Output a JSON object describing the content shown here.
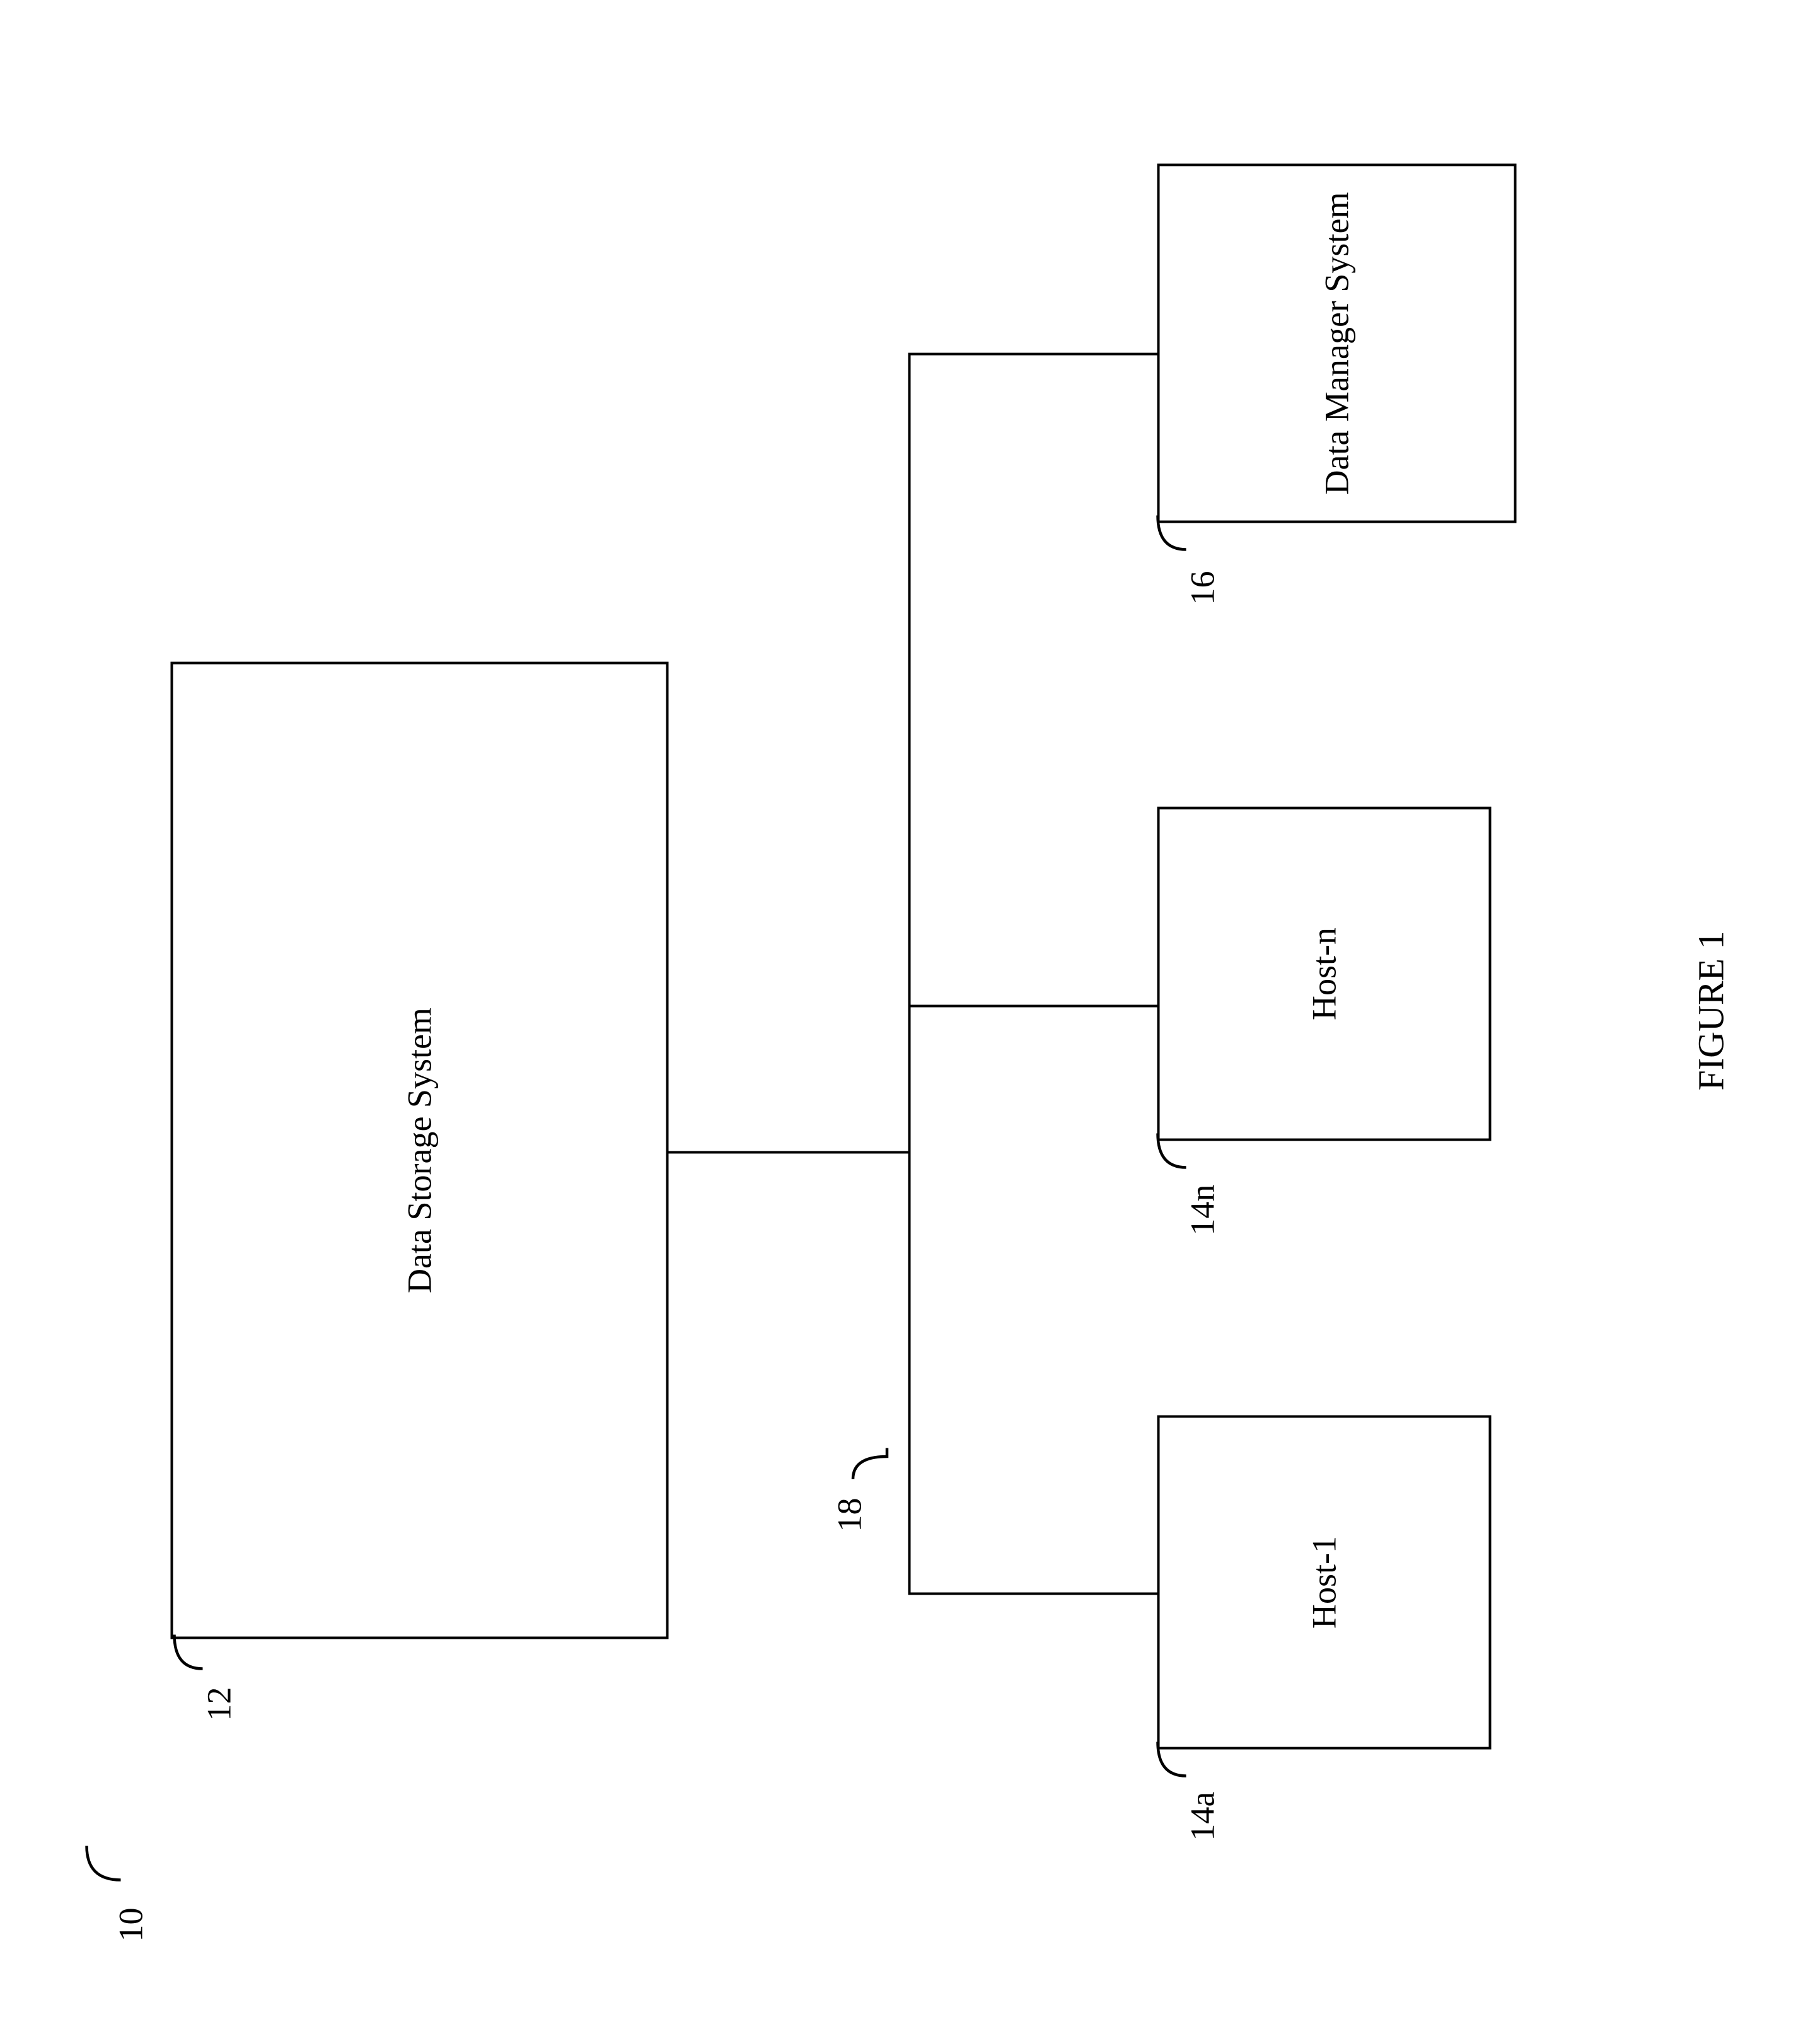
{
  "diagram": {
    "ref_overall": "10",
    "top_box": {
      "label": "Data Storage System",
      "ref": "12"
    },
    "bus_ref": "18",
    "bottom": [
      {
        "label": "Host-1",
        "ref": "14a"
      },
      {
        "label": "Host-n",
        "ref": "14n"
      },
      {
        "label": "Data Manager System",
        "ref": "16"
      }
    ],
    "caption": "FIGURE 1"
  }
}
